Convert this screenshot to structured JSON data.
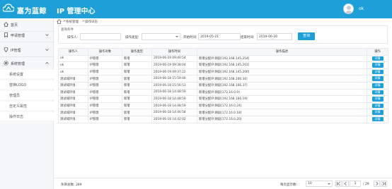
{
  "header": {
    "logo_text": "嘉为蓝鲸",
    "app_title": "IP 管理中心",
    "username": "ok"
  },
  "sidebar": {
    "items": [
      {
        "label": "首页"
      },
      {
        "label": "申请管理"
      },
      {
        "label": "IP管理"
      },
      {
        "label": "系统管理"
      }
    ],
    "subitems": [
      {
        "label": "系统设置"
      },
      {
        "label": "替换LOGO"
      },
      {
        "label": "管理员"
      },
      {
        "label": "自定义属性"
      },
      {
        "label": "操作日志"
      }
    ]
  },
  "breadcrumb": {
    "parent": "系统管理",
    "separator": ">",
    "current": "操作日志"
  },
  "search": {
    "panel_title": "查询条件",
    "operator_label": "操作人:",
    "operator_value": "",
    "type_label": "操作类型:",
    "type_value": "",
    "start_label": "开始时间:",
    "start_value": "2019-05-21",
    "end_label": "结束时间:",
    "end_value": "2019-06-20",
    "query_button": "查询"
  },
  "table": {
    "headers": [
      "操作人",
      "操作对象",
      "操作类型",
      "操作时间",
      "操作描述",
      "操作"
    ],
    "detail_label": "详情",
    "rows": [
      {
        "operator": "ok",
        "object": "IP管理",
        "type": "新增",
        "time": "2019-06-19 09:40:54",
        "desc": "新增分配IP:网段[192.168.145.254]"
      },
      {
        "operator": "ok",
        "object": "IP管理",
        "type": "新增",
        "time": "2019-06-19 09:38:04",
        "desc": "新增分配IP:网段[192.168.145.201]"
      },
      {
        "operator": "ok",
        "object": "IP管理",
        "type": "新增",
        "time": "2019-06-19 09:37:22",
        "desc": "新增分配IP:网段[192.168.145.200]"
      },
      {
        "operator": "测试域环境",
        "object": "IP管理",
        "type": "新增",
        "time": "2019-06-18 15:59:46",
        "desc": "新增分配IP:网段[192.168.166.34]"
      },
      {
        "operator": "测试域环境",
        "object": "IP管理",
        "type": "新增",
        "time": "2019-06-18 15:56:53",
        "desc": "新增分配IP:网段[192.168.166.37]"
      },
      {
        "operator": "测试域环境",
        "object": "IP管理",
        "type": "新增",
        "time": "2019-06-18 14:48:59",
        "desc": "新增分配IP:网段[172.16.0.9]"
      },
      {
        "operator": "测试域环境",
        "object": "IP管理",
        "type": "新增",
        "time": "2019-06-18 14:48:59",
        "desc": "新增分配IP:网段[192.168.166.19]"
      },
      {
        "operator": "测试域环境",
        "object": "IP管理",
        "type": "新增",
        "time": "2019-06-18 14:48:59",
        "desc": "新增分配IP:网段[172.16.0.24]"
      },
      {
        "operator": "测试域环境",
        "object": "IP管理",
        "type": "新增",
        "time": "2019-06-18 14:46:58",
        "desc": "新增分配IP:网段[172.16.0.18]"
      },
      {
        "operator": "测试域环境",
        "object": "IP管理",
        "type": "新增",
        "time": "2019-06-18 14:42:02",
        "desc": "新增分配IP:网段[172.16.0.20]"
      }
    ]
  },
  "footer": {
    "total_label": "条目总数: 289",
    "page_size_label": "每页显示数:",
    "page_size": "10",
    "current_page": "1",
    "total_pages": "/ 29"
  },
  "colors": {
    "primary": "#1e9fd8",
    "sidebar_bg": "#f6f7f9",
    "border": "#e6e9ed"
  },
  "icons": {
    "logo": "cloud-logo-icon",
    "avatar": "user-avatar",
    "home": "home-icon",
    "apply": "bookmark-icon",
    "ip": "pin-icon",
    "system": "gear-icon"
  }
}
